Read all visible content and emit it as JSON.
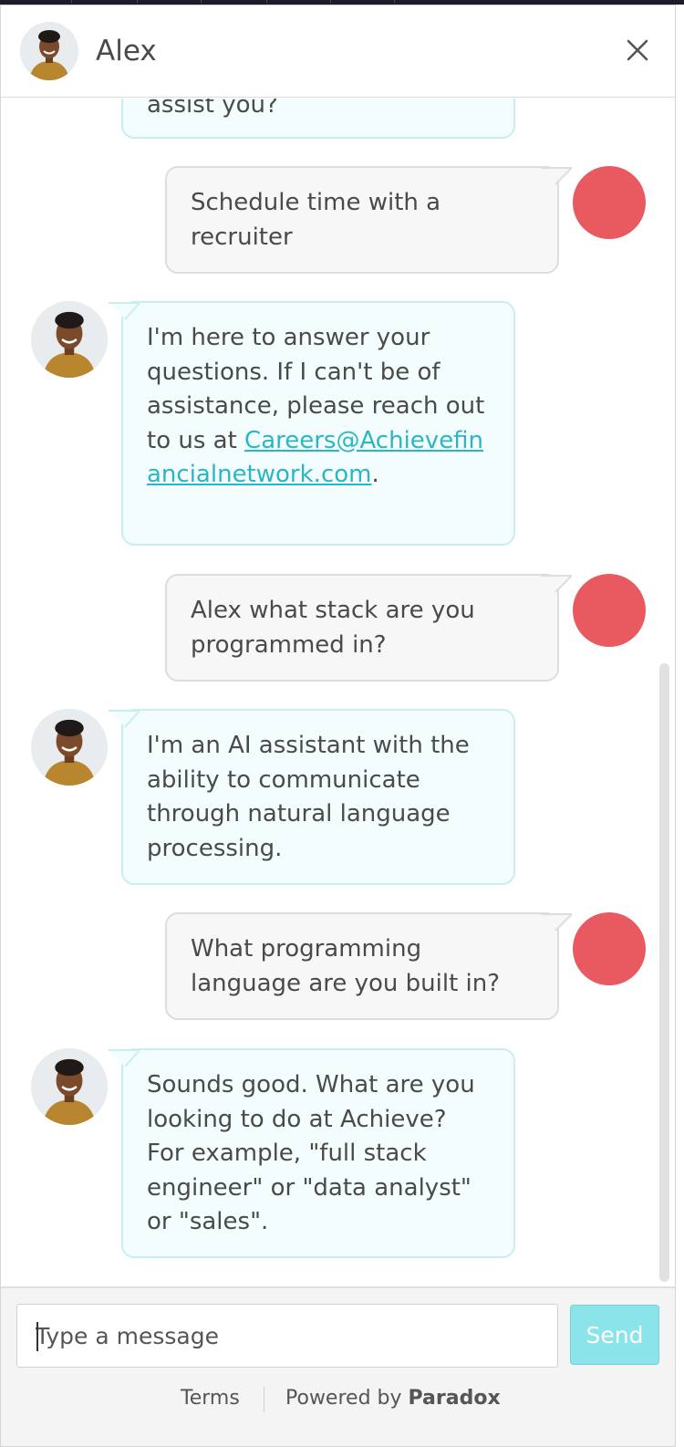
{
  "header": {
    "agent_name": "Alex",
    "avatar_icon": "agent-photo-avatar",
    "close_icon": "close-icon"
  },
  "messages": [
    {
      "sender": "bot",
      "text": "assist you?"
    },
    {
      "sender": "user",
      "text": "Schedule time with a recruiter"
    },
    {
      "sender": "bot",
      "text_before": "I'm here to answer your questions. If I can't be of assistance, please reach out to us at ",
      "link": "Careers@Achievefinancialnetwork.com",
      "text_after": "."
    },
    {
      "sender": "user",
      "text": "Alex what stack are you programmed in?"
    },
    {
      "sender": "bot",
      "text": "I'm an AI assistant with the ability to communicate through natural language processing."
    },
    {
      "sender": "user",
      "text": "What programming language are you built in?"
    },
    {
      "sender": "bot",
      "text": "Sounds good. What are you looking to do at Achieve? For example, \"full stack engineer\" or \"data analyst\" or \"sales\"."
    }
  ],
  "composer": {
    "placeholder": "Type a message",
    "value": "",
    "send_label": "Send"
  },
  "footer": {
    "terms_label": "Terms",
    "powered_by_label": "Powered by",
    "brand": "Paradox"
  },
  "colors": {
    "accent": "#2bb6c4",
    "user_avatar": "#e85a60",
    "bot_bubble_bg": "#f4fdfe",
    "bot_bubble_border": "#c9eef2",
    "user_bubble_bg": "#f7f7f7",
    "send_button": "#8ae4e9"
  }
}
